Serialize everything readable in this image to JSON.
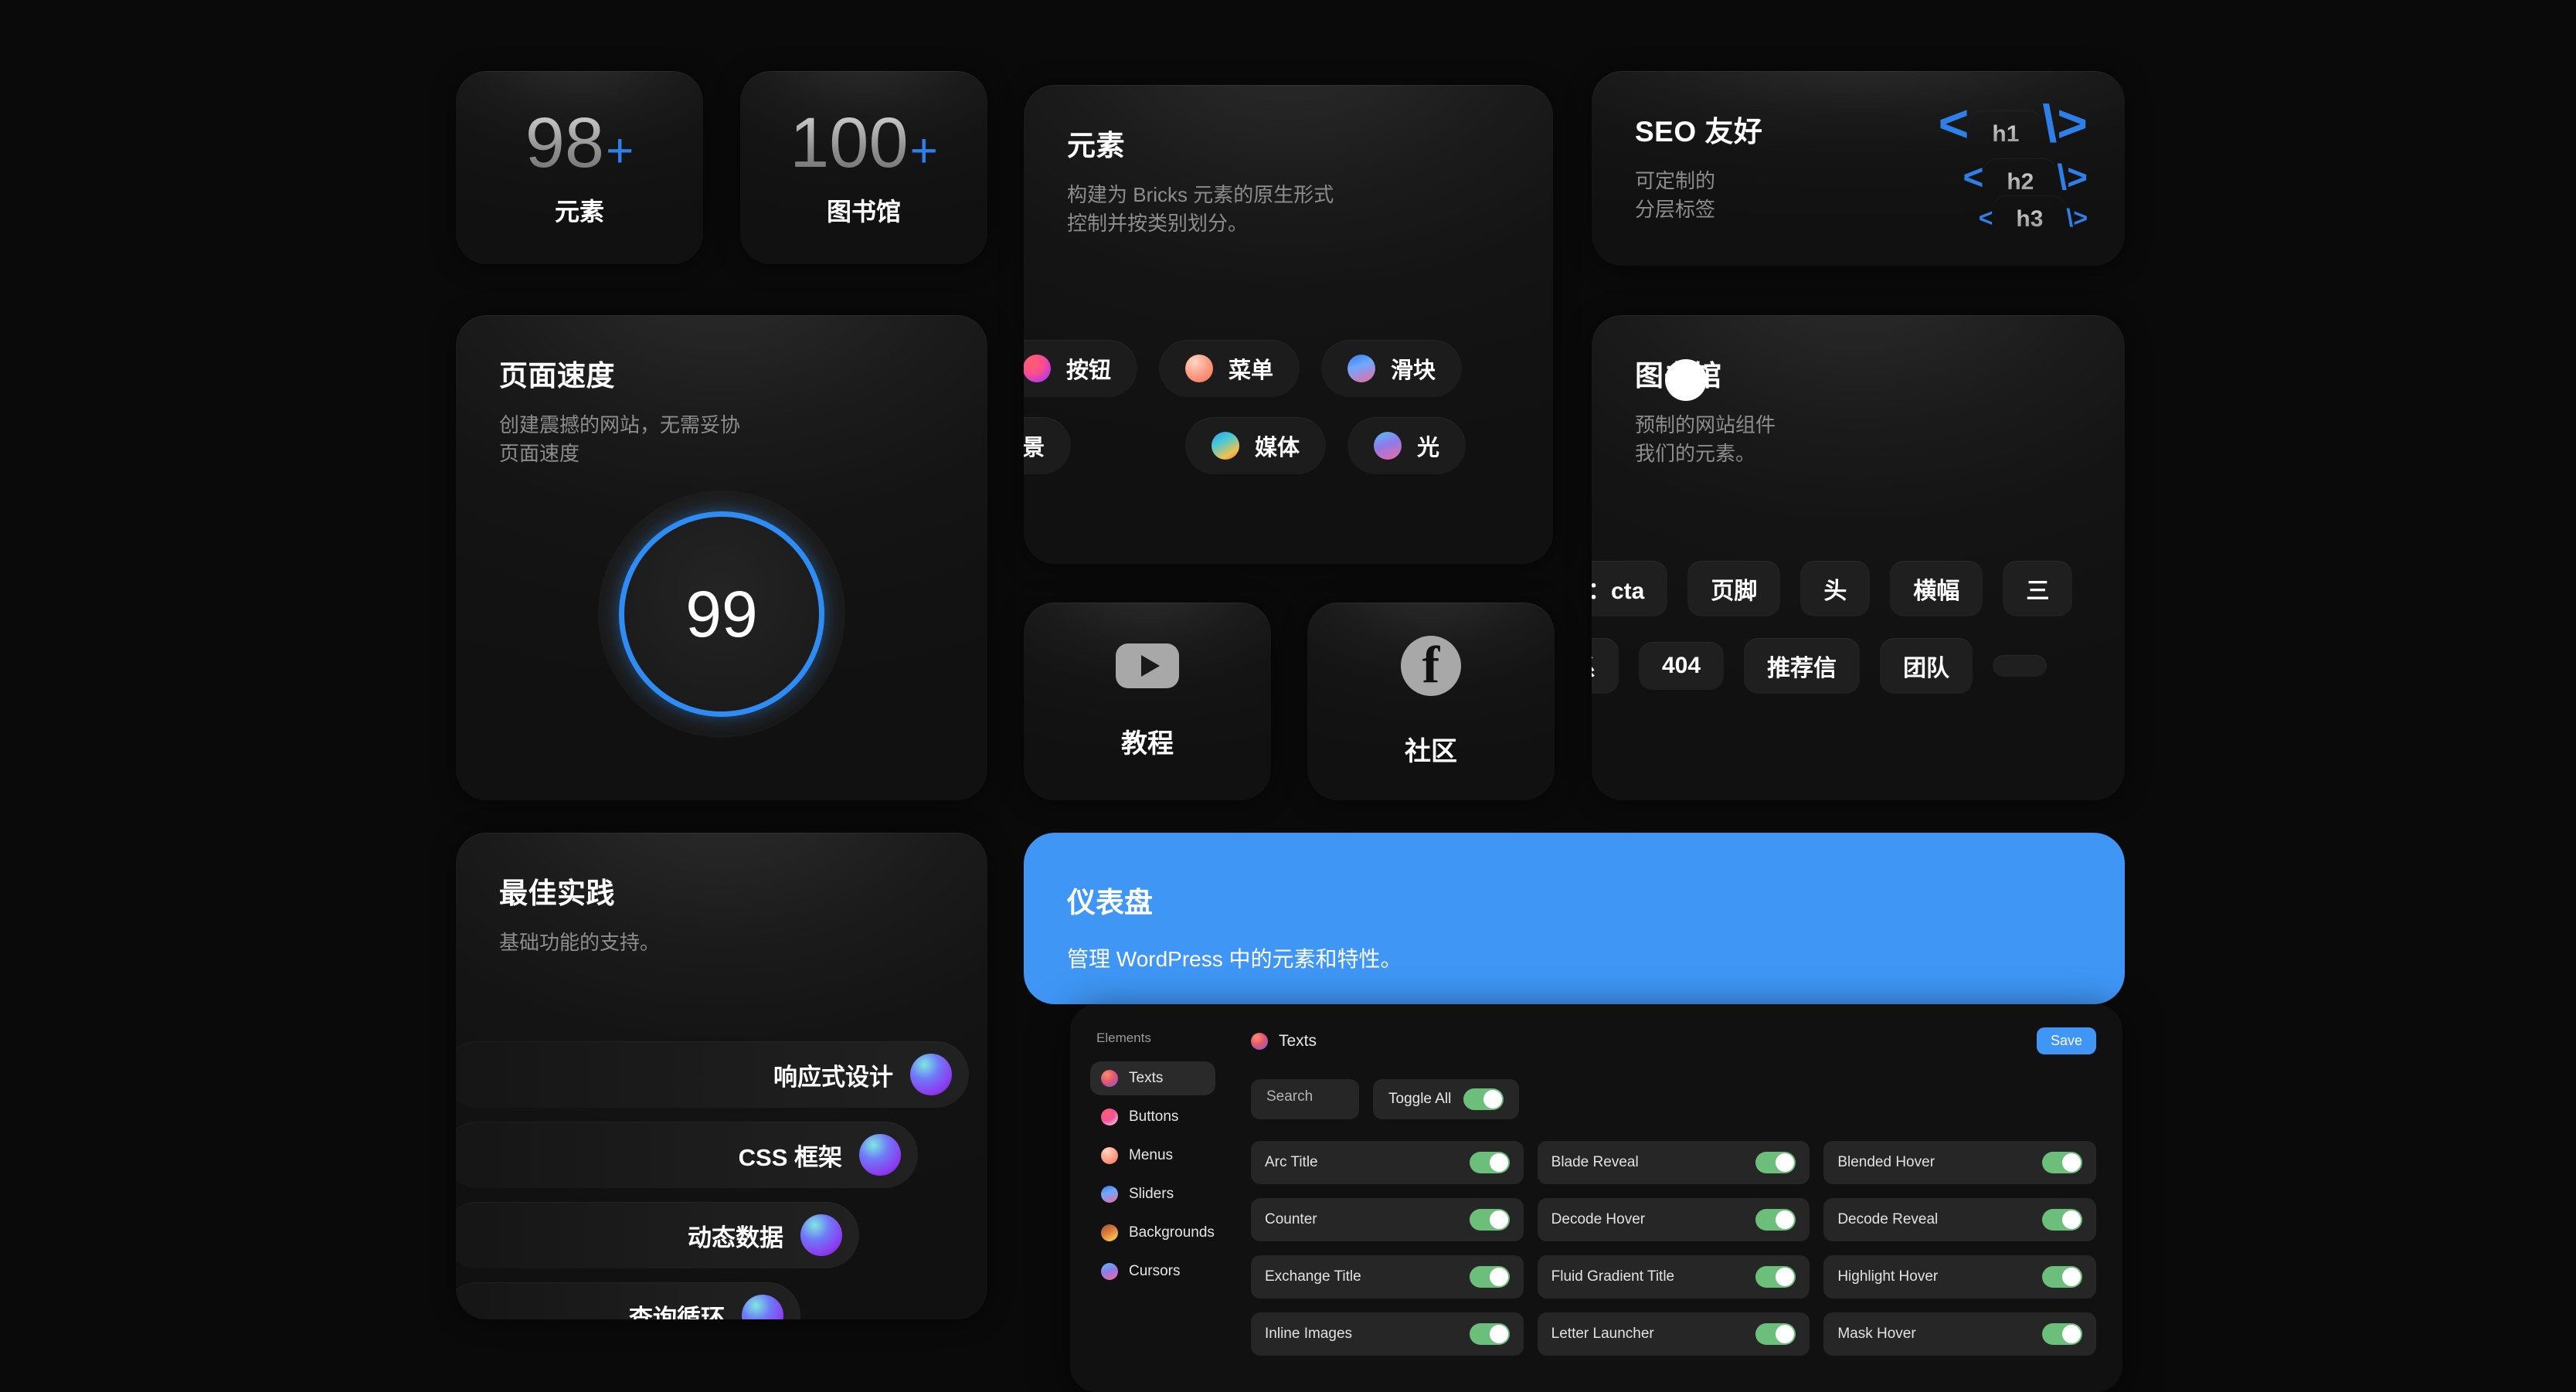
{
  "stats": [
    {
      "number": "98",
      "plus": "+",
      "label": "元素"
    },
    {
      "number": "100",
      "plus": "+",
      "label": "图书馆"
    }
  ],
  "elements_card": {
    "title": "元素",
    "subtitle": "构建为 Bricks 元素的原生形式\n控制并按类别划分。",
    "pills_row1": [
      {
        "label": "按钮",
        "orb": "orb-pink"
      },
      {
        "label": "菜单",
        "orb": "orb-peach"
      },
      {
        "label": "滑块",
        "orb": "orb-blue"
      }
    ],
    "pills_row2": [
      {
        "label": "背景",
        "orb": ""
      },
      {
        "label": "媒体",
        "orb": "orb-teal"
      },
      {
        "label": "光",
        "orb": "orb-magenta"
      }
    ]
  },
  "seo_card": {
    "title": "SEO 友好",
    "subtitle": "可定制的\n分层标签",
    "code_lines": [
      {
        "open": "<",
        "tag": "h1",
        "close": "\\>"
      },
      {
        "open": "<",
        "tag": "h2",
        "close": "\\>"
      },
      {
        "open": "<",
        "tag": "h3",
        "close": "\\>"
      }
    ]
  },
  "speed_card": {
    "title": "页面速度",
    "subtitle": "创建震撼的网站，无需妥协\n页面速度",
    "score": "99",
    "accent": "#2f8cf5"
  },
  "library_card": {
    "title": "图书馆",
    "subtitle": "预制的网站组件\n我们的元素。",
    "tags_row1": [
      "文是：cta",
      "页脚",
      "头",
      "横幅",
      "三"
    ],
    "tags_row2": [
      "联系",
      "404",
      "推荐信",
      "团队",
      ""
    ]
  },
  "social_cards": [
    {
      "label": "教程",
      "icon": "youtube-icon"
    },
    {
      "label": "社区",
      "icon": "facebook-icon"
    }
  ],
  "best_practice": {
    "title": "最佳实践",
    "subtitle": "基础功能的支持。",
    "items": [
      "响应式设计",
      "CSS 框架",
      "动态数据",
      "查询循环"
    ]
  },
  "dashboard": {
    "title": "仪表盘",
    "subtitle": "管理 WordPress 中的元素和特性。",
    "accent": "#3f96f5",
    "sidebar": {
      "heading": "Elements",
      "items": [
        {
          "label": "Texts",
          "active": true
        },
        {
          "label": "Buttons",
          "active": false
        },
        {
          "label": "Menus",
          "active": false
        },
        {
          "label": "Sliders",
          "active": false
        },
        {
          "label": "Backgrounds",
          "active": false
        },
        {
          "label": "Cursors",
          "active": false
        }
      ]
    },
    "main": {
      "section_title": "Texts",
      "save_label": "Save",
      "search_placeholder": "Search",
      "toggle_all_label": "Toggle All",
      "toggle_all_on": true,
      "features": [
        {
          "name": "Arc Title",
          "on": true
        },
        {
          "name": "Blade Reveal",
          "on": true
        },
        {
          "name": "Blended Hover",
          "on": true
        },
        {
          "name": "Counter",
          "on": true
        },
        {
          "name": "Decode Hover",
          "on": true
        },
        {
          "name": "Decode Reveal",
          "on": true
        },
        {
          "name": "Exchange Title",
          "on": true
        },
        {
          "name": "Fluid Gradient Title",
          "on": true
        },
        {
          "name": "Highlight Hover",
          "on": true
        },
        {
          "name": "Inline Images",
          "on": true
        },
        {
          "name": "Letter Launcher",
          "on": true
        },
        {
          "name": "Mask Hover",
          "on": true
        }
      ]
    }
  }
}
